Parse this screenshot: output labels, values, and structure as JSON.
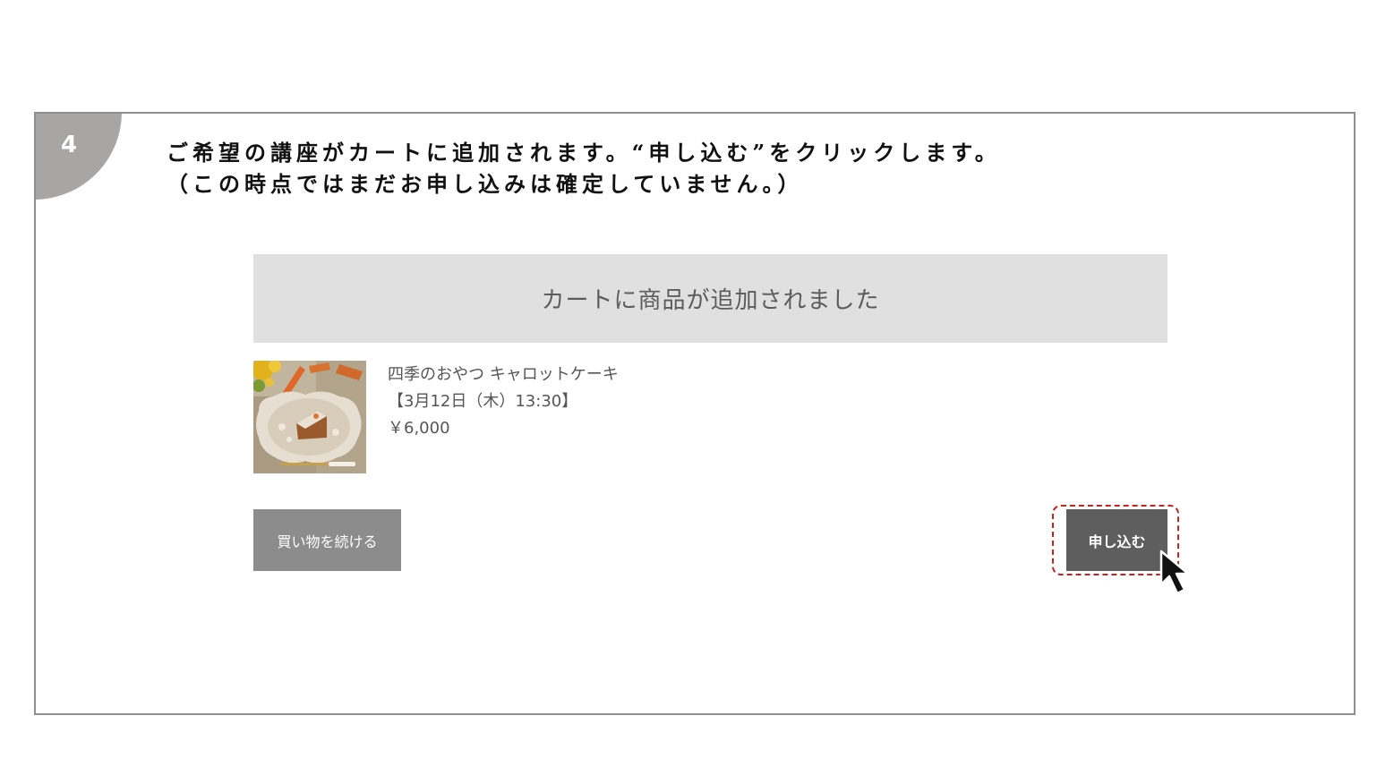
{
  "step": {
    "number": "4",
    "instruction_line1": "ご希望の講座がカートに追加されます。“申し込む”をクリックします。",
    "instruction_line2": "（この時点ではまだお申し込みは確定していません。）"
  },
  "cart": {
    "banner_text": "カートに商品が追加されました",
    "item": {
      "name": "四季のおやつ キャロットケーキ",
      "schedule": "【3月12日（木）13:30】",
      "price": "￥6,000",
      "thumbnail_icon": "carrot-cake-photo"
    },
    "continue_label": "買い物を続ける",
    "apply_label": "申し込む"
  },
  "colors": {
    "badge": "#a8a6a5",
    "banner_bg": "#e0e0e0",
    "continue_bg": "#8c8c8c",
    "apply_bg": "#5e5e5e",
    "highlight": "#c8221f"
  },
  "icons": {
    "cursor": "mouse-pointer-icon"
  }
}
